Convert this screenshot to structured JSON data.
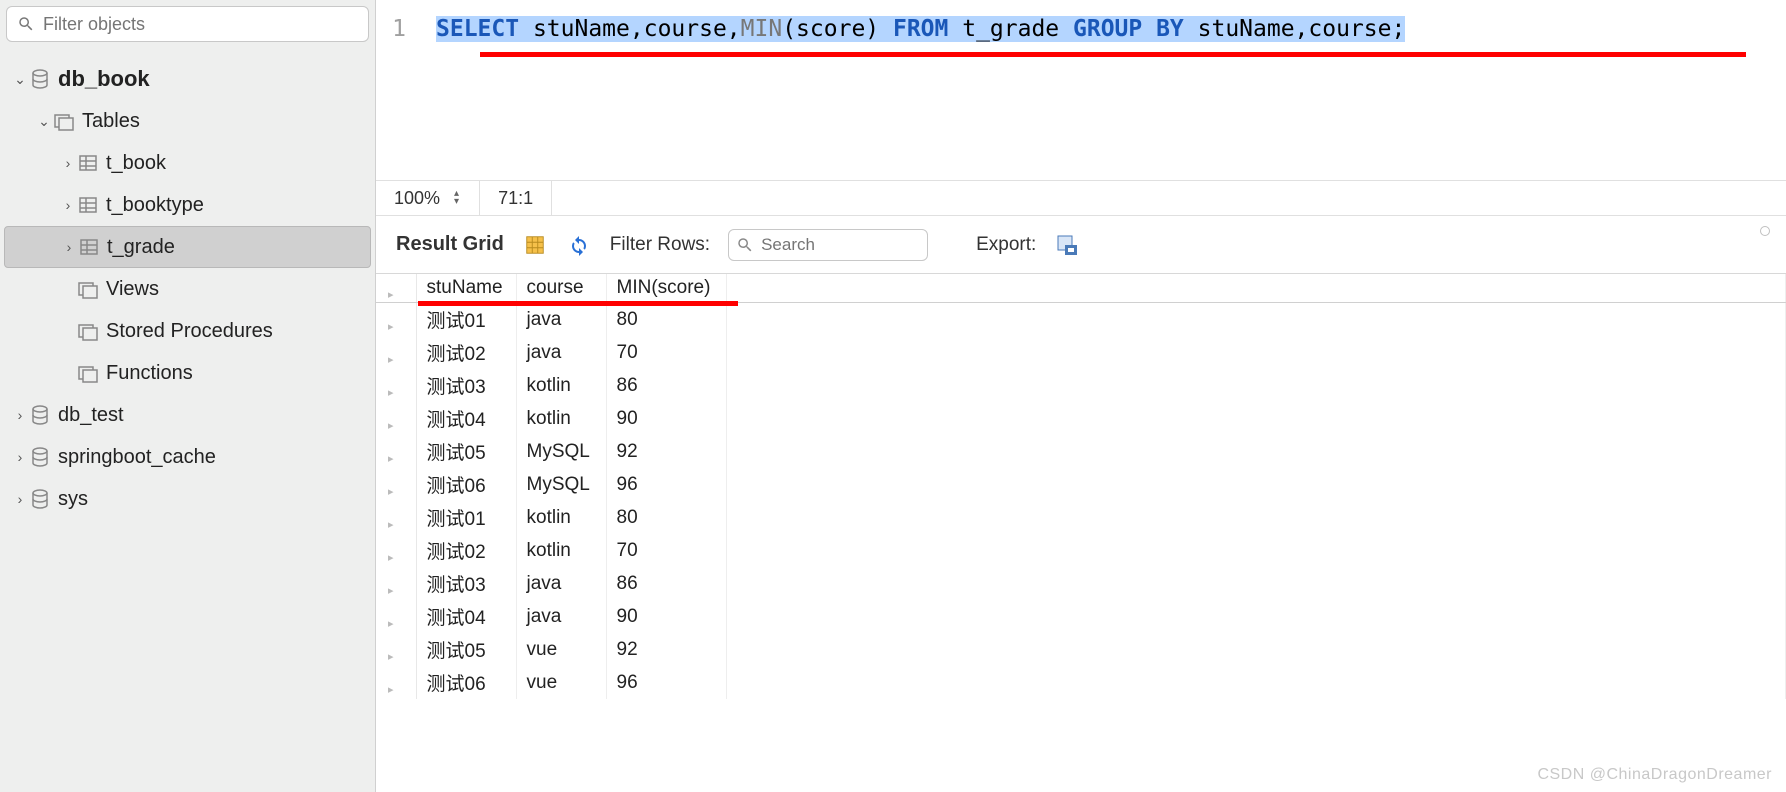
{
  "sidebar": {
    "search_placeholder": "Filter objects",
    "tree": [
      {
        "label": "db_book",
        "type": "db",
        "expanded": true,
        "bold": true,
        "indent": 0,
        "arrow": "v"
      },
      {
        "label": "Tables",
        "type": "folder",
        "expanded": true,
        "indent": 1,
        "arrow": "v"
      },
      {
        "label": "t_book",
        "type": "table",
        "indent": 2,
        "arrow": ">"
      },
      {
        "label": "t_booktype",
        "type": "table",
        "indent": 2,
        "arrow": ">"
      },
      {
        "label": "t_grade",
        "type": "table",
        "indent": 2,
        "arrow": ">",
        "selected": true
      },
      {
        "label": "Views",
        "type": "folder",
        "indent": 2,
        "arrow": ""
      },
      {
        "label": "Stored Procedures",
        "type": "folder",
        "indent": 2,
        "arrow": ""
      },
      {
        "label": "Functions",
        "type": "folder",
        "indent": 2,
        "arrow": ""
      },
      {
        "label": "db_test",
        "type": "db",
        "indent": 0,
        "arrow": ">"
      },
      {
        "label": "springboot_cache",
        "type": "db",
        "indent": 0,
        "arrow": ">"
      },
      {
        "label": "sys",
        "type": "db",
        "indent": 0,
        "arrow": ">"
      }
    ]
  },
  "editor": {
    "line_number": "1",
    "sql_tokens": [
      {
        "t": "SELECT",
        "c": "kw"
      },
      {
        "t": " stuName,course,",
        "c": "txt"
      },
      {
        "t": "MIN",
        "c": "fn"
      },
      {
        "t": "(score) ",
        "c": "txt"
      },
      {
        "t": "FROM",
        "c": "kw"
      },
      {
        "t": " t_grade ",
        "c": "txt"
      },
      {
        "t": "GROUP BY",
        "c": "kw"
      },
      {
        "t": " stuName,course;",
        "c": "txt"
      }
    ]
  },
  "status": {
    "zoom": "100%",
    "position": "71:1"
  },
  "result": {
    "title": "Result Grid",
    "filter_label": "Filter Rows:",
    "filter_placeholder": "Search",
    "export_label": "Export:",
    "columns": [
      "stuName",
      "course",
      "MIN(score)"
    ],
    "rows": [
      [
        "测试01",
        "java",
        "80"
      ],
      [
        "测试02",
        "java",
        "70"
      ],
      [
        "测试03",
        "kotlin",
        "86"
      ],
      [
        "测试04",
        "kotlin",
        "90"
      ],
      [
        "测试05",
        "MySQL",
        "92"
      ],
      [
        "测试06",
        "MySQL",
        "96"
      ],
      [
        "测试01",
        "kotlin",
        "80"
      ],
      [
        "测试02",
        "kotlin",
        "70"
      ],
      [
        "测试03",
        "java",
        "86"
      ],
      [
        "测试04",
        "java",
        "90"
      ],
      [
        "测试05",
        "vue",
        "92"
      ],
      [
        "测试06",
        "vue",
        "96"
      ]
    ]
  },
  "watermark": "CSDN @ChinaDragonDreamer"
}
